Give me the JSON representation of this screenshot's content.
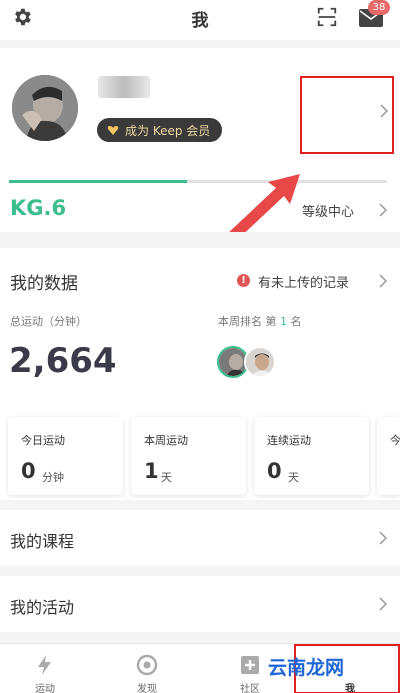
{
  "header": {
    "title": "我",
    "mail_badge": "38"
  },
  "profile": {
    "vip_label": "成为 Keep 会员"
  },
  "level": {
    "badge": "KG.6",
    "progress": 0.47,
    "link_label": "等级中心"
  },
  "my_data": {
    "title": "我的数据",
    "upload_warning": "有未上传的记录",
    "total_label": "总运动（分钟）",
    "total_value": "2,664",
    "rank_prefix": "本周排名",
    "rank_value": "第 1 名",
    "rank_parts": {
      "pre": "第",
      "num": "1",
      "post": "名"
    },
    "cards": [
      {
        "title": "今日运动",
        "value": "0",
        "unit": "分钟"
      },
      {
        "title": "本周运动",
        "value": "1",
        "unit": "天"
      },
      {
        "title": "连续运动",
        "value": "0",
        "unit": "天"
      },
      {
        "title": "今",
        "value": "",
        "unit": ""
      }
    ]
  },
  "menu": {
    "courses": "我的课程",
    "activities": "我的活动"
  },
  "tabbar": {
    "tabs": [
      {
        "label": "运动",
        "icon": "bolt-icon"
      },
      {
        "label": "发现",
        "icon": "discover-icon"
      },
      {
        "label": "社区",
        "icon": "community-icon"
      },
      {
        "label": "我",
        "icon": "me-icon"
      }
    ]
  },
  "watermark": "云南龙网",
  "colors": {
    "accent": "#3cbe8c",
    "annotation": "#e02020",
    "vip_bg": "#3a3a3a",
    "badge": "#e86a6a"
  }
}
